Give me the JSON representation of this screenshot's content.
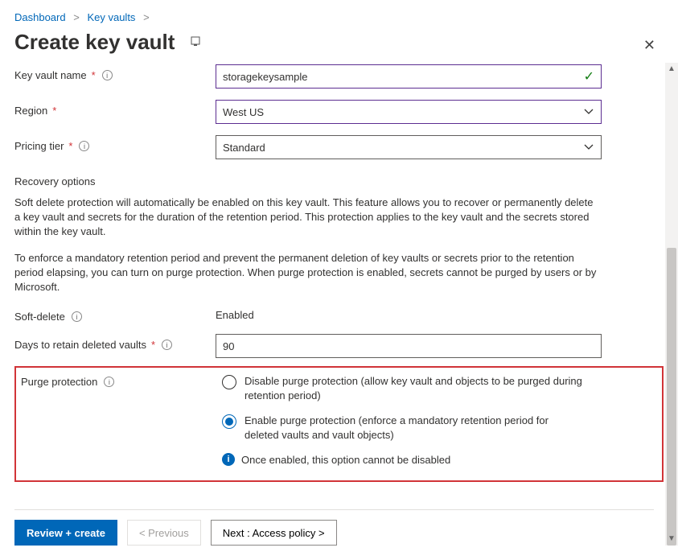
{
  "breadcrumb": {
    "items": [
      "Dashboard",
      "Key vaults"
    ]
  },
  "header": {
    "title": "Create key vault"
  },
  "fields": {
    "name_label": "Key vault name",
    "name_value": "storagekeysample",
    "region_label": "Region",
    "region_value": "West US",
    "tier_label": "Pricing tier",
    "tier_value": "Standard"
  },
  "recovery": {
    "heading": "Recovery options",
    "para1": "Soft delete protection will automatically be enabled on this key vault. This feature allows you to recover or permanently delete a key vault and secrets for the duration of the retention period. This protection applies to the key vault and the secrets stored within the key vault.",
    "para2": "To enforce a mandatory retention period and prevent the permanent deletion of key vaults or secrets prior to the retention period elapsing, you can turn on purge protection. When purge protection is enabled, secrets cannot be purged by users or by Microsoft.",
    "softdelete_label": "Soft-delete",
    "softdelete_value": "Enabled",
    "days_label": "Days to retain deleted vaults",
    "days_value": "90",
    "purge_label": "Purge protection",
    "purge_opt_disable": "Disable purge protection (allow key vault and objects to be purged during retention period)",
    "purge_opt_enable": "Enable purge protection (enforce a mandatory retention period for deleted vaults and vault objects)",
    "purge_note": "Once enabled, this option cannot be disabled"
  },
  "footer": {
    "review": "Review + create",
    "prev": "< Previous",
    "next": "Next : Access policy >"
  }
}
